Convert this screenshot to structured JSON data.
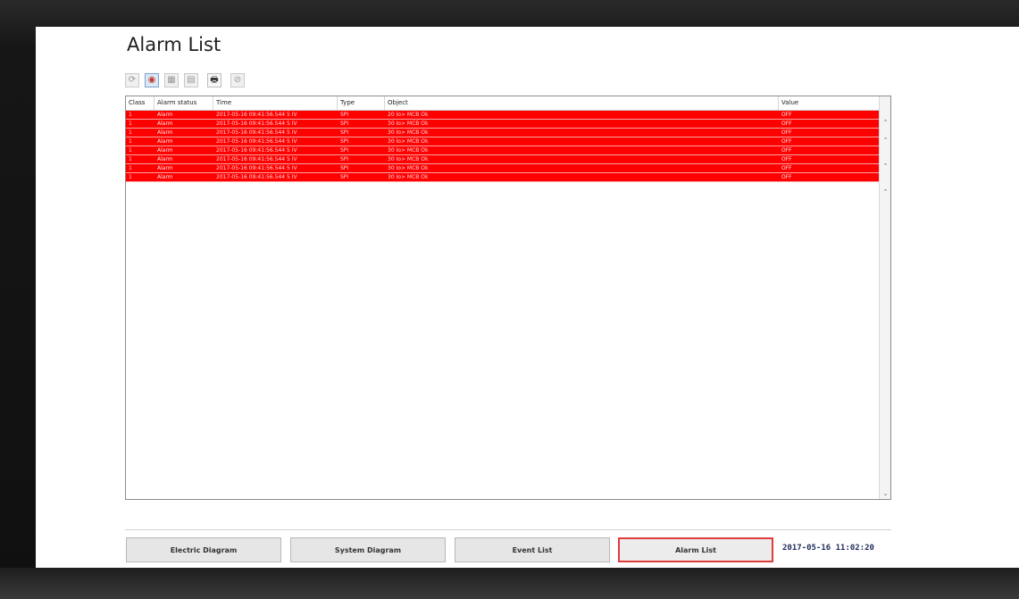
{
  "page": {
    "title": "Alarm List"
  },
  "toolbar": {
    "buttons": [
      {
        "name": "refresh",
        "glyph": "⟳"
      },
      {
        "name": "acknowledge",
        "glyph": "◉"
      },
      {
        "name": "ack-all",
        "glyph": "▦"
      },
      {
        "name": "filter",
        "glyph": "▤"
      },
      {
        "name": "print",
        "glyph": "🖶"
      },
      {
        "name": "silence",
        "glyph": "⊘"
      }
    ]
  },
  "grid": {
    "columns": {
      "class": "Class",
      "status": "Alarm status",
      "time": "Time",
      "type": "Type",
      "object": "Object",
      "value": "Value"
    },
    "rows": [
      {
        "class": "1",
        "status": "Alarm",
        "time": "2017-05-16 09:41:56.544 5 IV",
        "type": "SPI",
        "object": "20 Io> MCB Ok",
        "value": "OFF"
      },
      {
        "class": "1",
        "status": "Alarm",
        "time": "2017-05-16 09:41:56.544 5 IV",
        "type": "SPI",
        "object": "30 Io> MCB Ok",
        "value": "OFF"
      },
      {
        "class": "1",
        "status": "Alarm",
        "time": "2017-05-16 09:41:56.544 5 IV",
        "type": "SPI",
        "object": "30 Io> MCB Ok",
        "value": "OFF"
      },
      {
        "class": "1",
        "status": "Alarm",
        "time": "2017-05-16 09:41:56.544 5 IV",
        "type": "SPI",
        "object": "30 Io> MCB Ok",
        "value": "OFF"
      },
      {
        "class": "1",
        "status": "Alarm",
        "time": "2017-05-16 09:41:56.544 5 IV",
        "type": "SPI",
        "object": "30 Io> MCB Ok",
        "value": "OFF"
      },
      {
        "class": "1",
        "status": "Alarm",
        "time": "2017-05-16 09:41:56.544 5 IV",
        "type": "SPI",
        "object": "30 Io> MCB Ok",
        "value": "OFF"
      },
      {
        "class": "1",
        "status": "Alarm",
        "time": "2017-05-16 09:41:56.544 5 IV",
        "type": "SPI",
        "object": "30 Io> MCB Ok",
        "value": "OFF"
      },
      {
        "class": "1",
        "status": "Alarm",
        "time": "2017-05-16 09:41:56.544 5 IV",
        "type": "SPI",
        "object": "30 Io> MCB Ok",
        "value": "OFF"
      }
    ],
    "row_color": "#ff0000"
  },
  "nav": {
    "electric_diagram": "Electric Diagram",
    "system_diagram": "System Diagram",
    "event_list": "Event List",
    "alarm_list": "Alarm List"
  },
  "status": {
    "datetime": "2017-05-16 11:02:20"
  },
  "colors": {
    "alarm_row": "#ff0000",
    "selected_border": "#e03c3c",
    "clock_text": "#1f2a5a"
  }
}
